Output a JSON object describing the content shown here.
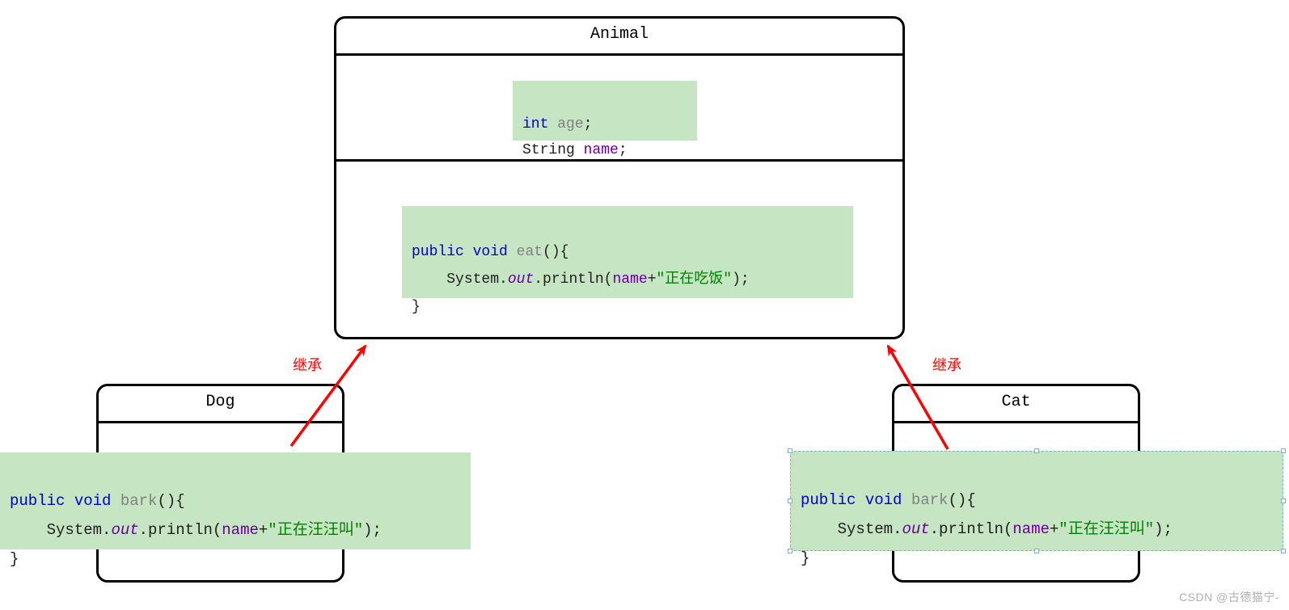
{
  "animal": {
    "name": "Animal",
    "fields": {
      "type1": "int",
      "var1": "age",
      "type2": "String",
      "var2": "name"
    },
    "method": {
      "mods": "public void",
      "fname": "eat",
      "sys": "System.",
      "out": "out",
      "println": ".println(",
      "arg": "name",
      "plus": "+",
      "str": "\"正在吃饭\"",
      "close": ");"
    }
  },
  "dog": {
    "name": "Dog",
    "method": {
      "mods_public": "public",
      "mods_void": "void",
      "fname": "bark",
      "sys": "System.",
      "out": "out",
      "println": ".println(",
      "arg": "name",
      "plus": "+",
      "str": "\"正在汪汪叫\"",
      "close": ");"
    }
  },
  "cat": {
    "name": "Cat",
    "method": {
      "mods_public": "public",
      "mods_void": "void",
      "fname": "bark",
      "sys": "System.",
      "out": "out",
      "println": ".println(",
      "arg": "name",
      "plus": "+",
      "str": "\"正在汪汪叫\"",
      "close": ");"
    }
  },
  "labels": {
    "inherit": "继承"
  },
  "watermark": "CSDN @古德猫宁-"
}
